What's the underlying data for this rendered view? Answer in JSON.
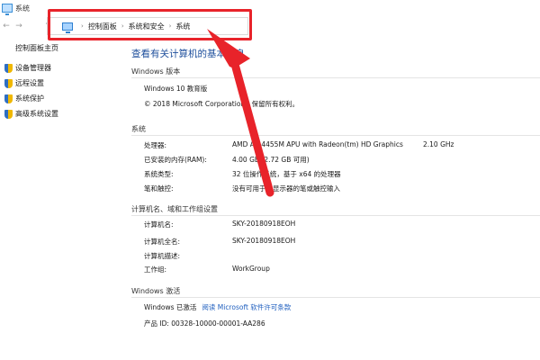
{
  "window": {
    "title": "系统"
  },
  "address": {
    "crumbs": [
      "控制面板",
      "系统和安全",
      "系统"
    ]
  },
  "nav": {
    "back": "←",
    "forward": "→",
    "up": "↑"
  },
  "sidebar": {
    "home": "控制面板主页",
    "items": [
      {
        "label": "设备管理器"
      },
      {
        "label": "远程设置"
      },
      {
        "label": "系统保护"
      },
      {
        "label": "高级系统设置"
      }
    ]
  },
  "main": {
    "title": "查看有关计算机的基本信息",
    "edition": {
      "heading": "Windows 版本",
      "name": "Windows 10 教育版",
      "copyright": "© 2018 Microsoft Corporation。保留所有权利。"
    },
    "system": {
      "heading": "系统",
      "rows": [
        {
          "label": "处理器:",
          "value": "AMD A6-4455M APU with Radeon(tm) HD Graphics",
          "extra": "2.10 GHz"
        },
        {
          "label": "已安装的内存(RAM):",
          "value": "4.00 GB (2.72 GB 可用)"
        },
        {
          "label": "系统类型:",
          "value": "32 位操作系统，基于 x64 的处理器"
        },
        {
          "label": "笔和触控:",
          "value": "没有可用于此显示器的笔或触控输入"
        }
      ]
    },
    "computer": {
      "heading": "计算机名、域和工作组设置",
      "rows": [
        {
          "label": "计算机名:",
          "value": "SKY-20180918EOH"
        },
        {
          "label": "计算机全名:",
          "value": "SKY-20180918EOH"
        },
        {
          "label": "计算机描述:",
          "value": ""
        },
        {
          "label": "工作组:",
          "value": "WorkGroup"
        }
      ]
    },
    "activation": {
      "heading": "Windows 激活",
      "status": "Windows 已激活",
      "license_link": "阅读 Microsoft 软件许可条款",
      "product_id": "产品 ID: 00328-10000-00001-AA286"
    }
  },
  "annotation": {
    "color": "#e8232a"
  }
}
